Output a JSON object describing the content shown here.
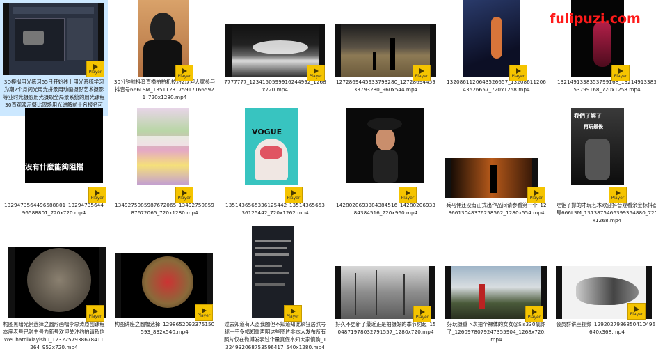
{
  "watermark": "fulipuzi.com",
  "badge_label": "Player",
  "thumb_text": {
    "t7": "沒有什麼能夠阻擋",
    "t9": "VOGUE",
    "t12": "我們了解了",
    "t12b": "再玩最後"
  },
  "files": [
    {
      "name": "3D模拟用光练习55日开始线上用光系统学习为期2个月闪光用光拼景用动画摄影艺术摄影等业时光摄影用光摄取全局景系统的用光课程30直观演示摄比现场用光讲解前十名报名可获得拿..."
    },
    {
      "name": "30分钟前抖音直播拍拍机技巧2欢迎大家参与抖音号666LSM_13511231759171665921_720x1280.mp4"
    },
    {
      "name": "7777777_1234150599916244992_1268x720.mp4"
    },
    {
      "name": "1272869445933793280_1272869445933793280_960x544.mp4"
    },
    {
      "name": "1320861120643526657_1320861120643526657_720x1258.mp4"
    },
    {
      "name": "1321491338353799168_1321491338353799168_720x1258.mp4"
    },
    {
      "name": "1329473564496588801_1329473564496588801_720x720.mp4"
    },
    {
      "name": "1349275085987672065_1349275085987672065_720x1280.mp4"
    },
    {
      "name": "1351436565336125442_1351436565336125442_720x1262.mp4"
    },
    {
      "name": "1428020693384384516_1428020693384384516_720x960.mp4"
    },
    {
      "name": "兵马俑还没有正式出作品间请参看第一个_1236613048376258562_1280x554.mp4"
    },
    {
      "name": "吃饱了撑的才玩艺术欢迎抖音观看余金标抖音号666LSM_1313875466399354880_720x1268.mp4"
    },
    {
      "name": "构图黑暗光例选择之圆形画幅李思涛原创课程本座老号已封主号为新号欢迎关注约拍请私信WeChatdixiayishu_1232257938678411264_952x720.mp4"
    },
    {
      "name": "构图讲座之圆幅选择_1298652092375150593_832x540.mp4"
    },
    {
      "name": "过去知道有人盗我图但不知道知此疯狂居然号称一千多幅郑重声明这些图片非本人发布所有照片仅在微博发表过个量真假本知大家慎购_1324932068753596417_540x1280.mp4"
    },
    {
      "name": "好久不更新了最近正是拍摄好的季节约起_1504871978032791557_1280x720.mp4"
    },
    {
      "name": "好玩摄重下次拍个裸体的女女@Sis330靓你了_1260978079247355904_1268x720.mp4"
    },
    {
      "name": "会员群讲座视频_1292027986850410496_640x368.mp4"
    }
  ]
}
